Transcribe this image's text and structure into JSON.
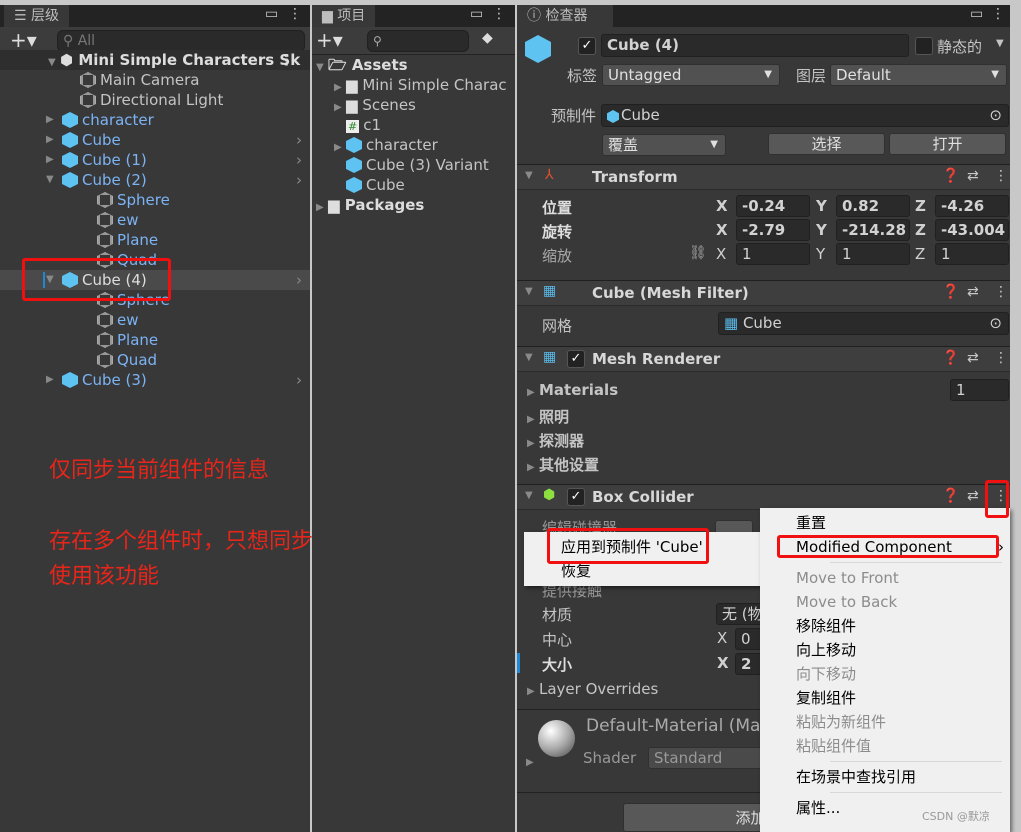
{
  "hierarchy": {
    "tab": "层级",
    "search_placeholder": "All",
    "scene": "Mini Simple Characters Sk",
    "items": [
      {
        "label": "Main Camera",
        "prefab": false
      },
      {
        "label": "Directional Light",
        "prefab": false
      },
      {
        "label": "character",
        "prefab": true
      },
      {
        "label": "Cube",
        "prefab": true
      },
      {
        "label": "Cube (1)",
        "prefab": true
      },
      {
        "label": "Cube (2)",
        "prefab": true
      },
      {
        "label": "Sphere"
      },
      {
        "label": "ew"
      },
      {
        "label": "Plane"
      },
      {
        "label": "Quad"
      },
      {
        "label": "Cube (4)",
        "selected": true
      },
      {
        "label": "Sphere"
      },
      {
        "label": "ew"
      },
      {
        "label": "Plane"
      },
      {
        "label": "Quad"
      },
      {
        "label": "Cube (3)",
        "prefab": true
      }
    ]
  },
  "annotations": {
    "line1": "仅同步当前组件的信息",
    "line2": "存在多个组件时，只想同步某一组件",
    "line3": "使用该功能"
  },
  "project": {
    "tab": "项目",
    "root": "Assets",
    "items": [
      "Mini Simple Charac",
      "Scenes",
      "c1",
      "character",
      "Cube (3) Variant",
      "Cube"
    ],
    "packages": "Packages"
  },
  "inspector": {
    "tab": "检查器",
    "name": "Cube (4)",
    "static_label": "静态的",
    "tag_label": "标签",
    "tag": "Untagged",
    "layer_label": "图层",
    "layer": "Default",
    "prefab_label": "预制件",
    "prefab": "Cube",
    "overrides": "覆盖",
    "select": "选择",
    "open": "打开",
    "transform": {
      "title": "Transform",
      "position_label": "位置",
      "position": [
        "-0.24",
        "0.82",
        "-4.26"
      ],
      "rotation_label": "旋转",
      "rotation": [
        "-2.79",
        "-214.28",
        "-43.004"
      ],
      "scale_label": "缩放",
      "scale": [
        "1",
        "1",
        "1"
      ],
      "axes": [
        "X",
        "Y",
        "Z"
      ]
    },
    "mesh_filter": {
      "title": "Cube (Mesh Filter)",
      "mesh_label": "网格",
      "mesh": "Cube"
    },
    "mesh_renderer": {
      "title": "Mesh Renderer",
      "materials": "Materials",
      "materials_count": "1",
      "lighting": "照明",
      "probes": "探测器",
      "other": "其他设置"
    },
    "box_collider": {
      "title": "Box Collider",
      "edit": "编辑碰撞器",
      "provides_contacts": "提供接触",
      "material_label": "材质",
      "material": "无 (物",
      "center_label": "中心",
      "center_x": "0",
      "size_label": "大小",
      "size_x": "2",
      "layer_overrides": "Layer Overrides"
    },
    "material": {
      "name": "Default-Material (Mate",
      "shader_label": "Shader",
      "shader": "Standard"
    },
    "add_component": "添加组件"
  },
  "submenu": {
    "apply": "应用到预制件 'Cube'",
    "revert": "恢复"
  },
  "context_menu": {
    "items": [
      {
        "label": "重置",
        "enabled": true
      },
      {
        "label": "Modified Component",
        "enabled": true,
        "submenu": true
      },
      {
        "label": "Move to Front",
        "enabled": false
      },
      {
        "label": "Move to Back",
        "enabled": false
      },
      {
        "label": "移除组件",
        "enabled": true
      },
      {
        "label": "向上移动",
        "enabled": true
      },
      {
        "label": "向下移动",
        "enabled": false
      },
      {
        "label": "复制组件",
        "enabled": true
      },
      {
        "label": "粘贴为新组件",
        "enabled": false
      },
      {
        "label": "粘贴组件值",
        "enabled": false
      },
      {
        "label": "在场景中查找引用",
        "enabled": true
      },
      {
        "label": "属性...",
        "enabled": true
      }
    ]
  },
  "watermark": "CSDN @默凉",
  "colors": {
    "highlight": "#f01010",
    "prefab_text": "#7cb3f4",
    "annotation": "#e8251a"
  }
}
